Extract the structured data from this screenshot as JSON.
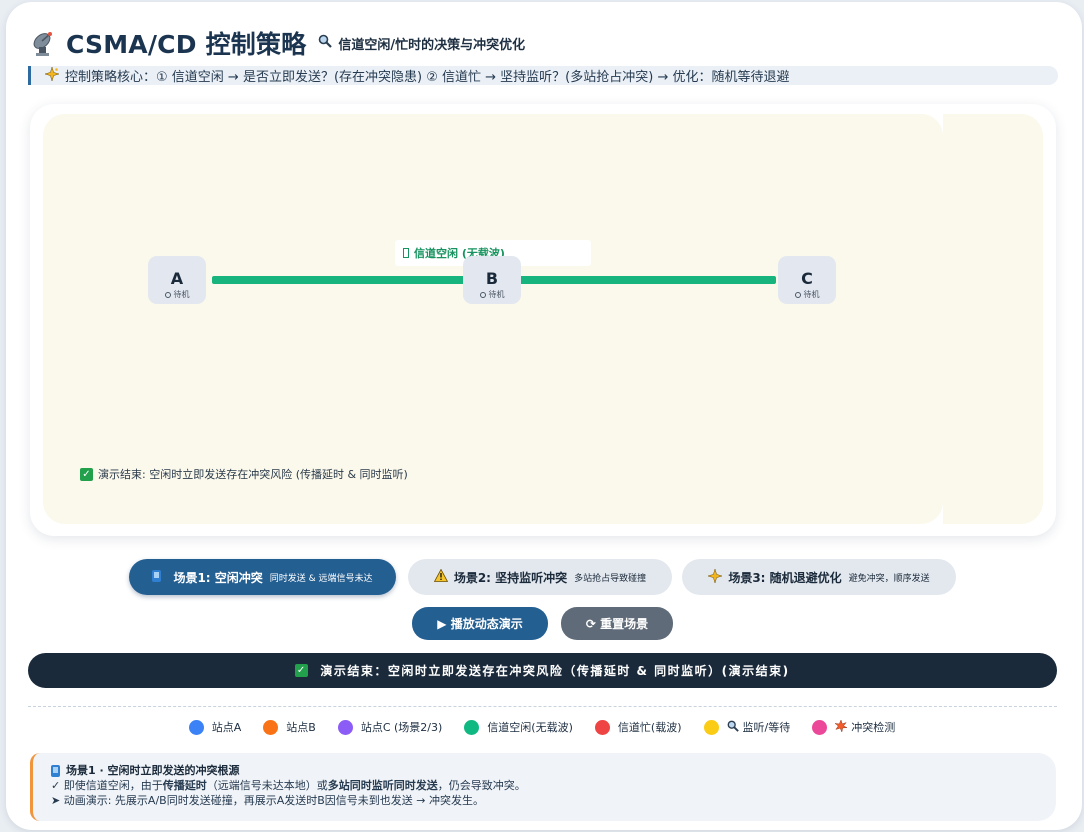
{
  "header": {
    "title": "CSMA/CD 控制策略",
    "subtitle": "信道空闲/忙时的决策与冲突优化",
    "core": "控制策略核心：① 信道空闲 → 是否立即发送？(存在冲突隐患)  ② 信道忙 → 坚持监听？(多站抢占冲突) → 优化：随机等待退避"
  },
  "stage": {
    "bus_label": "信道空闲 (无载波)",
    "nodes": [
      {
        "label": "A",
        "state": "待机"
      },
      {
        "label": "B",
        "state": "待机"
      },
      {
        "label": "C",
        "state": "待机"
      }
    ],
    "done_message": "演示结束: 空闲时立即发送存在冲突风险 (传播延时 & 同时监听)"
  },
  "scenes": [
    {
      "label": "场景1: 空闲冲突",
      "sub": "同时发送 & 远端信号未达",
      "active": true
    },
    {
      "label": "场景2: 坚持监听冲突",
      "sub": "多站抢占导致碰撞",
      "active": false
    },
    {
      "label": "场景3: 随机退避优化",
      "sub": "避免冲突，顺序发送",
      "active": false
    }
  ],
  "actions": {
    "play": "▶ 播放动态演示",
    "reset": "⟳ 重置场景"
  },
  "status": "演示结束：空闲时立即发送存在冲突风险（传播延时 & 同时监听）(演示结束)",
  "legend": [
    {
      "label": "站点A",
      "color": "#3b82f6"
    },
    {
      "label": "站点B",
      "color": "#f97316"
    },
    {
      "label": "站点C (场景2/3)",
      "color": "#8b5cf6"
    },
    {
      "label": "信道空闲(无载波)",
      "color": "#10b981"
    },
    {
      "label": "信道忙(载波)",
      "color": "#ef4444"
    },
    {
      "label": "监听/等待",
      "color": "#facc15",
      "icon": "magnifier-icon"
    },
    {
      "label": "冲突检测",
      "color": "#ec4899",
      "icon": "collision-icon"
    }
  ],
  "info": {
    "heading": "场景1 · 空闲时立即发送的冲突根源",
    "line1_a": "✓ 即使信道空闲，由于",
    "line1_b": "传播延时",
    "line1_c": "（远端信号未达本地）或",
    "line1_d": "多站同时监听同时发送",
    "line1_e": "，仍会导致冲突。",
    "line2": "➤ 动画演示: 先展示A/B同时发送碰撞，再展示A发送时B因信号未到也发送 → 冲突发生。"
  },
  "colors": {
    "accent": "#245f92",
    "bus_idle": "#17b57d",
    "status_bg": "#1a2a3a"
  }
}
